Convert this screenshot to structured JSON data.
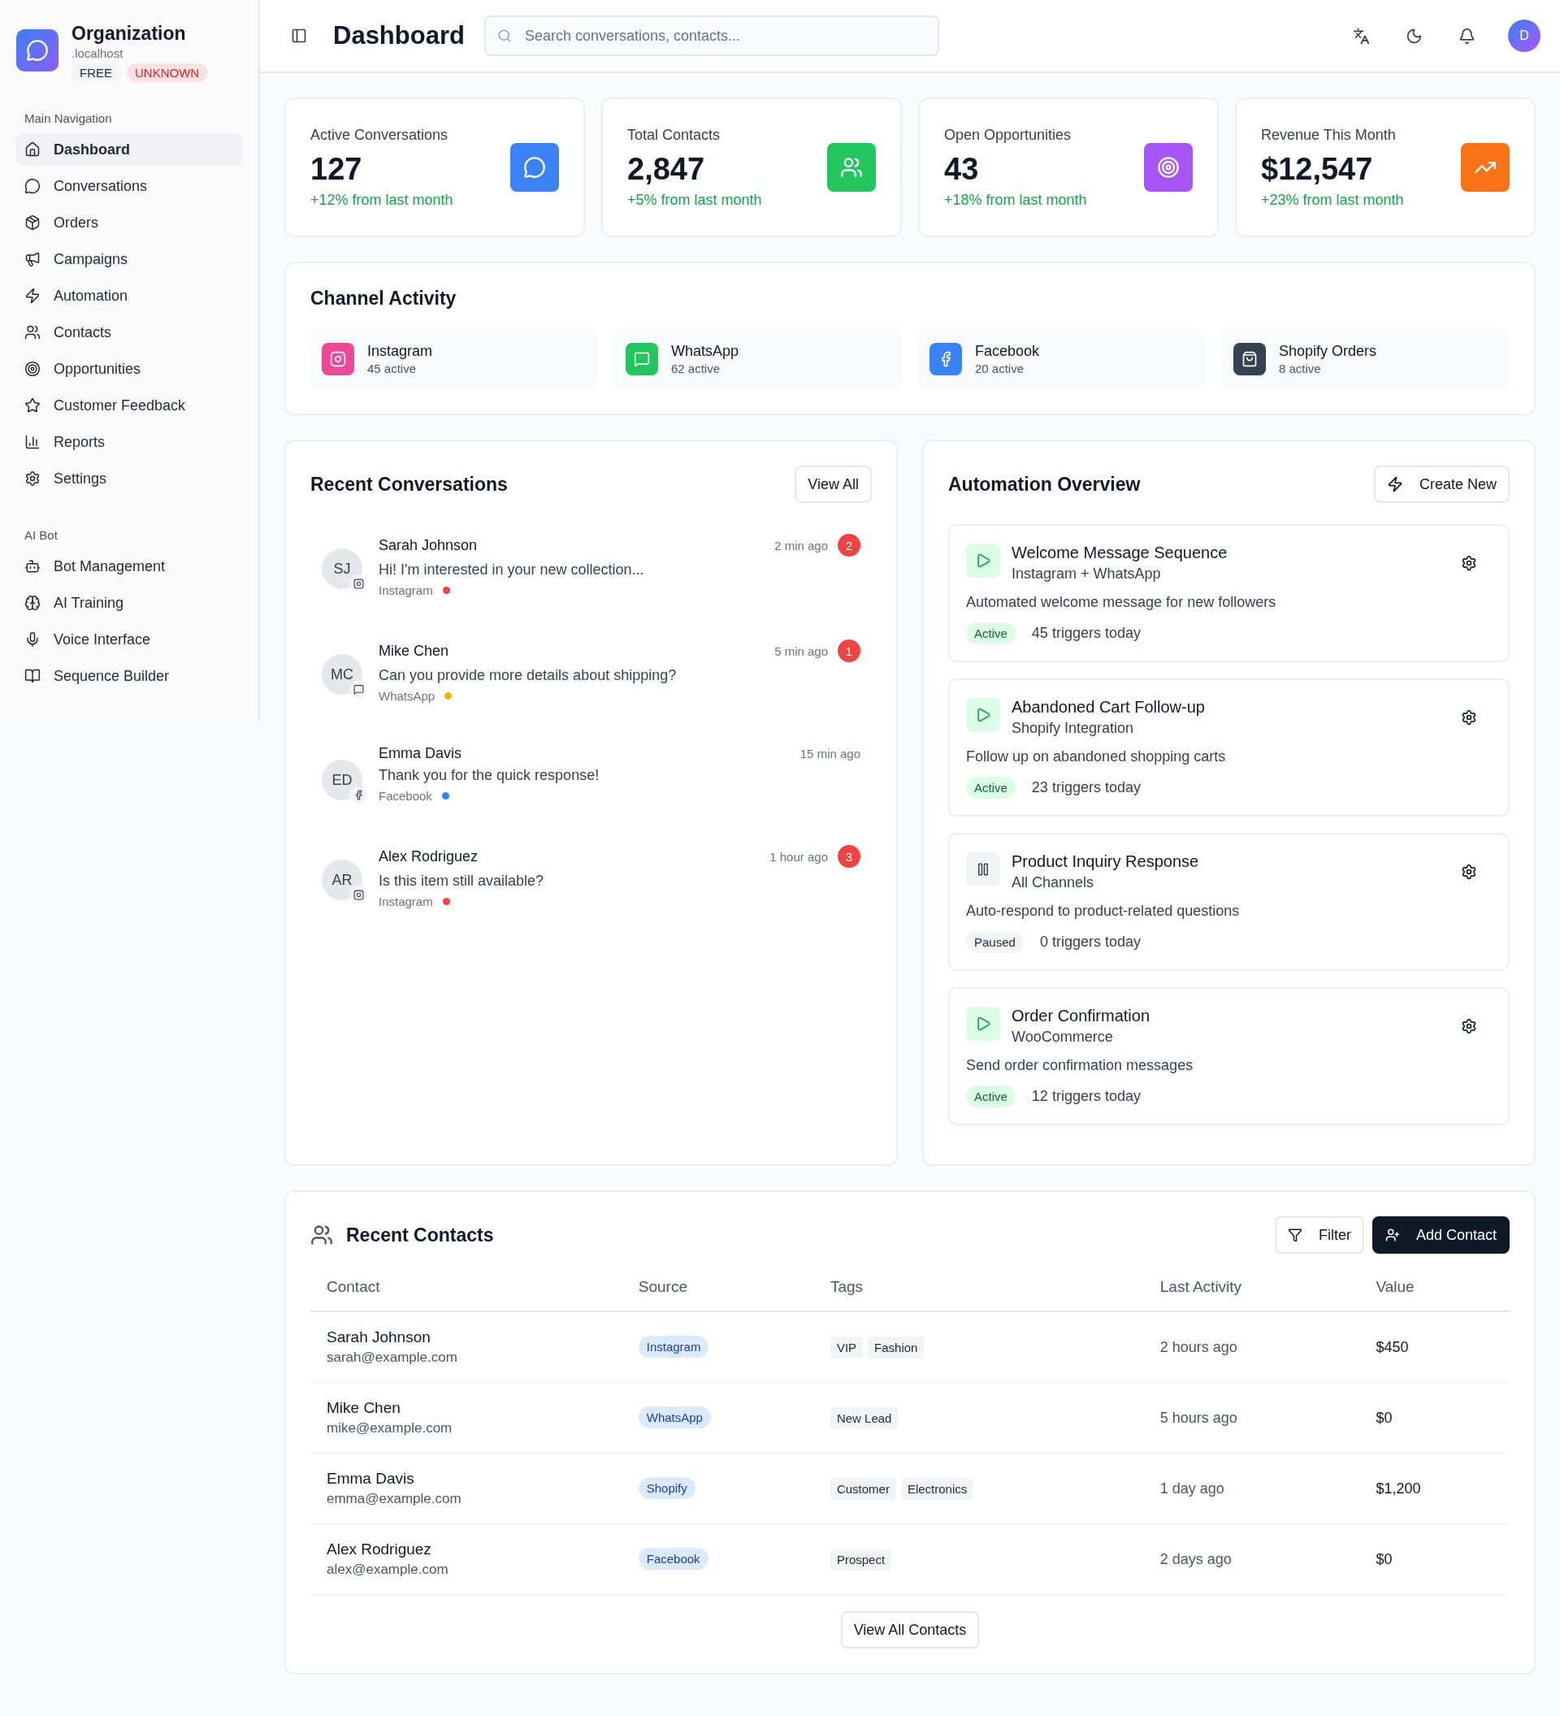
{
  "sidebar": {
    "org": {
      "name": "Organization",
      "domain": ".localhost",
      "badges": [
        {
          "label": "FREE",
          "kind": "plan"
        },
        {
          "label": "UNKNOWN",
          "kind": "warning"
        }
      ]
    },
    "sections": [
      {
        "title": "Main Navigation",
        "items": [
          {
            "label": "Dashboard",
            "selected": true
          },
          {
            "label": "Conversations",
            "selected": false
          },
          {
            "label": "Orders",
            "selected": false
          },
          {
            "label": "Campaigns",
            "selected": false
          },
          {
            "label": "Automation",
            "selected": false
          },
          {
            "label": "Contacts",
            "selected": false
          },
          {
            "label": "Opportunities",
            "selected": false
          },
          {
            "label": "Customer Feedback",
            "selected": false
          },
          {
            "label": "Reports",
            "selected": false
          },
          {
            "label": "Settings",
            "selected": false
          }
        ]
      },
      {
        "title": "AI Bot",
        "items": [
          {
            "label": "Bot Management",
            "selected": false
          },
          {
            "label": "AI Training",
            "selected": false
          },
          {
            "label": "Voice Interface",
            "selected": false
          },
          {
            "label": "Sequence Builder",
            "selected": false
          }
        ]
      }
    ]
  },
  "header": {
    "title": "Dashboard",
    "search": {
      "placeholder": "Search conversations, contacts..."
    },
    "avatar": "D"
  },
  "stats": [
    {
      "label": "Active Conversations",
      "value": "127",
      "change": "+12% from last month",
      "color": "#3b82f6"
    },
    {
      "label": "Total Contacts",
      "value": "2,847",
      "change": "+5% from last month",
      "color": "#22c55e"
    },
    {
      "label": "Open Opportunities",
      "value": "43",
      "change": "+18% from last month",
      "color": "#a855f7"
    },
    {
      "label": "Revenue This Month",
      "value": "$12,547",
      "change": "+23% from last month",
      "color": "#f97316"
    }
  ],
  "channel_activity": {
    "title": "Channel Activity",
    "channels": [
      {
        "name": "Instagram",
        "count": "45 active",
        "color": "#ec4899"
      },
      {
        "name": "WhatsApp",
        "count": "62 active",
        "color": "#22c55e"
      },
      {
        "name": "Facebook",
        "count": "20 active",
        "color": "#3b82f6"
      },
      {
        "name": "Shopify Orders",
        "count": "8 active",
        "color": "#374151"
      }
    ]
  },
  "recent_conversations": {
    "title": "Recent Conversations",
    "button": "View All",
    "items": [
      {
        "initials": "SJ",
        "name": "Sarah Johnson",
        "message": "Hi! I'm interested in your new collection...",
        "source": "Instagram",
        "kind": "instagram",
        "color": "#ef4444",
        "time": "2 min ago",
        "unread": "2"
      },
      {
        "initials": "MC",
        "name": "Mike Chen",
        "message": "Can you provide more details about shipping?",
        "source": "WhatsApp",
        "kind": "whatsapp",
        "color": "#eab308",
        "time": "5 min ago",
        "unread": "1"
      },
      {
        "initials": "ED",
        "name": "Emma Davis",
        "message": "Thank you for the quick response!",
        "source": "Facebook",
        "kind": "facebook",
        "color": "#3b82f6",
        "time": "15 min ago"
      },
      {
        "initials": "AR",
        "name": "Alex Rodriguez",
        "message": "Is this item still available?",
        "source": "Instagram",
        "kind": "instagram",
        "color": "#ef4444",
        "time": "1 hour ago",
        "unread": "3"
      }
    ]
  },
  "automation_overview": {
    "title": "Automation Overview",
    "button": "Create New",
    "items": [
      {
        "name": "Welcome Message Sequence",
        "channels": "Instagram + WhatsApp",
        "description": "Automated welcome message for new followers",
        "active": true,
        "status_label": "Active",
        "triggers": "45 triggers today"
      },
      {
        "name": "Abandoned Cart Follow-up",
        "channels": "Shopify Integration",
        "description": "Follow up on abandoned shopping carts",
        "active": true,
        "status_label": "Active",
        "triggers": "23 triggers today"
      },
      {
        "name": "Product Inquiry Response",
        "channels": "All Channels",
        "description": "Auto-respond to product-related questions",
        "active": false,
        "status_label": "Paused",
        "triggers": "0 triggers today"
      },
      {
        "name": "Order Confirmation",
        "channels": "WooCommerce",
        "description": "Send order confirmation messages",
        "active": true,
        "status_label": "Active",
        "triggers": "12 triggers today"
      }
    ]
  },
  "recent_contacts": {
    "title": "Recent Contacts",
    "filter_button": "Filter",
    "add_button": "Add Contact",
    "columns": [
      "Contact",
      "Source",
      "Tags",
      "Last Activity",
      "Value"
    ],
    "rows": [
      {
        "name": "Sarah Johnson",
        "email": "sarah@example.com",
        "source": "Instagram",
        "tags": [
          "VIP",
          "Fashion"
        ],
        "last_activity": "2 hours ago",
        "value": "$450"
      },
      {
        "name": "Mike Chen",
        "email": "mike@example.com",
        "source": "WhatsApp",
        "tags": [
          "New Lead"
        ],
        "last_activity": "5 hours ago",
        "value": "$0"
      },
      {
        "name": "Emma Davis",
        "email": "emma@example.com",
        "source": "Shopify",
        "tags": [
          "Customer",
          "Electronics"
        ],
        "last_activity": "1 day ago",
        "value": "$1,200"
      },
      {
        "name": "Alex Rodriguez",
        "email": "alex@example.com",
        "source": "Facebook",
        "tags": [
          "Prospect"
        ],
        "last_activity": "2 days ago",
        "value": "$0"
      }
    ],
    "footer_button": "View All Contacts"
  }
}
